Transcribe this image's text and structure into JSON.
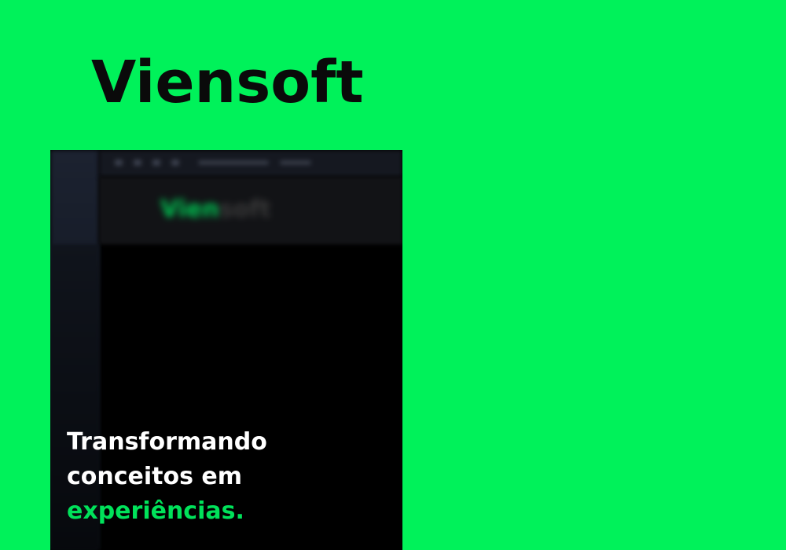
{
  "brand": {
    "title": "Viensoft",
    "background_color": "#00f25a",
    "title_color": "#0a0a0a"
  },
  "preview": {
    "logo_prefix": "Vien",
    "logo_suffix": "soft",
    "hero": {
      "line1": "Transformando",
      "line2": "conceitos em",
      "line3": "experiências."
    },
    "accent_color": "#00e25a",
    "background_color": "#000000"
  }
}
